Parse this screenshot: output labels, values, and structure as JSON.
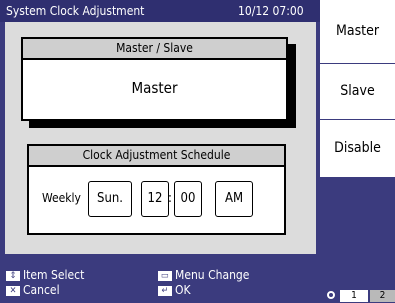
{
  "title_bar": {
    "title": "System Clock Adjustment",
    "datetime": "10/12 07:00"
  },
  "master_slave": {
    "header": "Master / Slave",
    "value": "Master"
  },
  "schedule": {
    "header": "Clock Adjustment Schedule",
    "frequency": "Weekly",
    "day": "Sun.",
    "hour": "12",
    "separator": ":",
    "minute": "00",
    "ampm": "AM"
  },
  "side_menu": {
    "options": [
      "Master",
      "Slave",
      "Disable"
    ]
  },
  "footer": {
    "item_select": "Item Select",
    "cancel": "Cancel",
    "menu_change": "Menu Change",
    "ok": "OK"
  },
  "pager": {
    "pages": [
      "1",
      "2"
    ]
  },
  "colors": {
    "background": "#3b3b7e",
    "panel": "#dcdcdc",
    "header_fill": "#cfcfcf"
  },
  "icons": [
    "up-down-arrow-icon",
    "cancel-icon",
    "menu-change-icon",
    "enter-icon",
    "page-dot-icon"
  ]
}
